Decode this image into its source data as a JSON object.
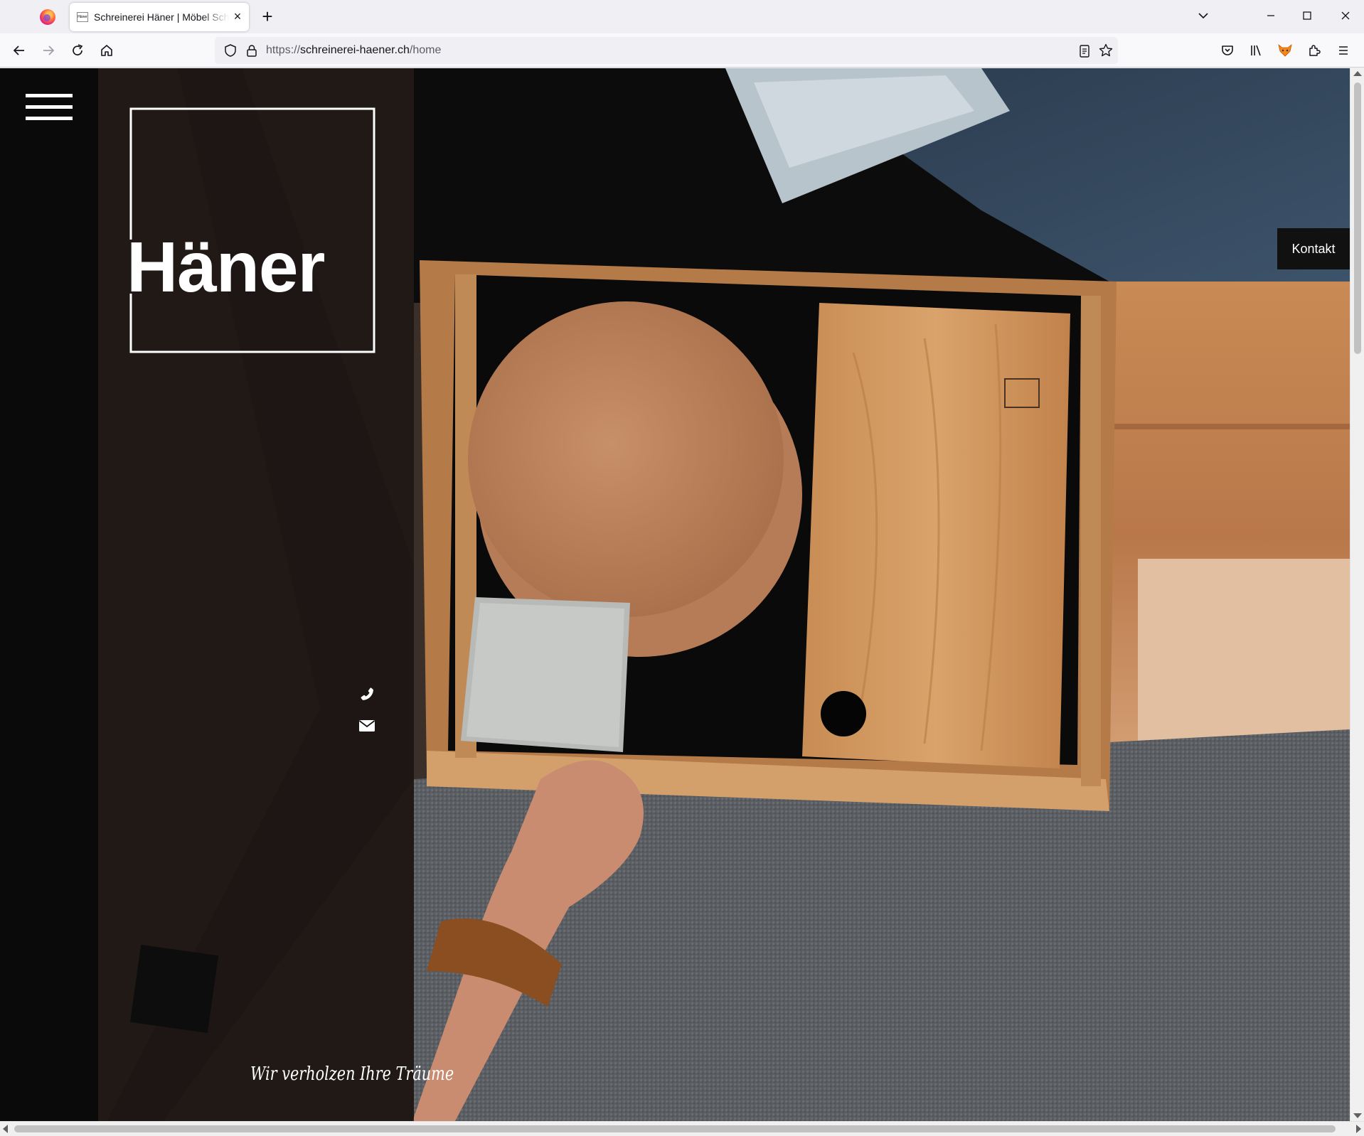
{
  "browser": {
    "tab_title": "Schreinerei Häner | Möbel Schreinerei",
    "tab_favicon_text": "Häner",
    "tab_close": "×",
    "new_tab": "+",
    "url_scheme": "https://",
    "url_host": "schreinerei-haener.ch",
    "url_path": "/home",
    "icons": [
      "firefox-icon",
      "tabs-list-icon",
      "minimize-icon",
      "maximize-icon",
      "close-icon",
      "back-icon",
      "forward-icon",
      "reload-icon",
      "home-icon",
      "shield-icon",
      "lock-icon",
      "reader-view-icon",
      "bookmark-star-icon",
      "pocket-icon",
      "library-icon",
      "fox-extension-icon",
      "extensions-icon",
      "app-menu-icon"
    ]
  },
  "page": {
    "logo_text": "Häner",
    "tagline": "Wir verholzen Ihre Träume",
    "kontakt_label": "Kontakt",
    "icons": [
      "hamburger-menu-icon",
      "phone-icon",
      "mail-icon"
    ],
    "colors": {
      "panel": "#0c0a0a",
      "text": "#ffffff",
      "kontakt_bg": "#111111"
    }
  }
}
